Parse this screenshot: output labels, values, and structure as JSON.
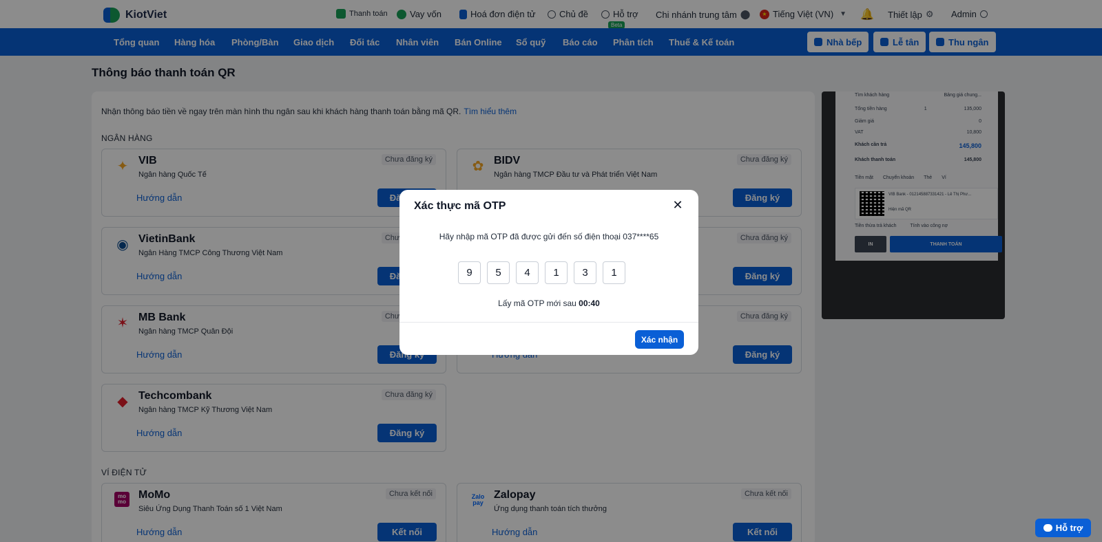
{
  "app": {
    "brand": "KiotViet"
  },
  "topbar": {
    "items": [
      {
        "label": "Thanh toán",
        "icon": "payment-icon"
      },
      {
        "label": "Vay vốn",
        "icon": "money-bag-icon"
      },
      {
        "label": "Hoá đơn điện tử",
        "icon": "invoice-icon"
      },
      {
        "label": "Chủ đề",
        "icon": "palette-icon"
      },
      {
        "label": "Hỗ trợ",
        "icon": "chat-icon"
      },
      {
        "label": "Chi nhánh trung tâm",
        "icon": "location-pin-icon"
      },
      {
        "label": "Tiếng Việt (VN)",
        "icon": "vietnam-flag-icon"
      },
      {
        "label": "Thiết lập",
        "icon": "gear-icon"
      },
      {
        "label": "Admin",
        "icon": "user-icon"
      }
    ],
    "beta_label": "Beta"
  },
  "nav": {
    "items": [
      "Tổng quan",
      "Hàng hóa",
      "Phòng/Bàn",
      "Giao dịch",
      "Đối tác",
      "Nhân viên",
      "Bán Online",
      "Sổ quỹ",
      "Báo cáo",
      "Phân tích",
      "Thuế & Kế toán"
    ],
    "buttons": [
      "Nhà bếp",
      "Lễ tân",
      "Thu ngân"
    ]
  },
  "page": {
    "title": "Thông báo thanh toán QR",
    "intro": "Nhận thông báo tiền về ngay trên màn hình thu ngân sau khi khách hàng thanh toán bằng mã QR.",
    "learn_more": "Tìm hiểu thêm",
    "section_banks": "NGÂN HÀNG",
    "section_wallets": "VÍ ĐIỆN TỬ",
    "guide_label": "Hướng dẫn",
    "register_label": "Đăng ký",
    "connect_label": "Kết nối",
    "status_unregistered": "Chưa đăng ký",
    "status_unconnected": "Chưa kết nối"
  },
  "banks": [
    {
      "name": "VIB",
      "desc": "Ngân hàng Quốc Tế",
      "logo_color": "#f5a623"
    },
    {
      "name": "BIDV",
      "desc": "Ngân hàng TMCP Đầu tư và Phát triển Việt Nam",
      "logo_color": "#f5a623"
    },
    {
      "name": "VietinBank",
      "desc": "Ngân Hàng TMCP Công Thương Việt Nam",
      "logo_color": "#0a4a8f"
    },
    {
      "name": "MB Bank",
      "desc": "Ngân hàng TMCP Quân Đội",
      "logo_color": "#e01e2b"
    },
    {
      "name": "Techcombank",
      "desc": "Ngân hàng TMCP Kỹ Thương Việt Nam",
      "logo_color": "#e01e2b"
    }
  ],
  "wallets": [
    {
      "name": "MoMo",
      "desc": "Siêu Ứng Dụng Thanh Toán số 1 Việt Nam",
      "logo_text": "mo mo",
      "logo_color": "#a50064"
    },
    {
      "name": "Zalopay",
      "desc": "Ứng dụng thanh toán tích thưởng",
      "logo_text": "Zalo pay",
      "logo_color": "#0068ff"
    }
  ],
  "preview": {
    "search_placeholder": "Tìm khách hàng",
    "price_list": "Bảng giá chung...",
    "rows": [
      {
        "label": "Tổng tiền hàng",
        "value": "135,000",
        "qty": "1"
      },
      {
        "label": "Giảm giá",
        "value": "0"
      },
      {
        "label": "VAT",
        "value": "10,800"
      },
      {
        "label": "Khách cần trả",
        "value": "145,800"
      },
      {
        "label": "Khách thanh toán",
        "value": "145,800"
      }
    ],
    "methods": [
      "Tiền mặt",
      "Chuyển khoản",
      "Thẻ",
      "Ví"
    ],
    "bank_account": "VIB Bank - 012145887331421 - Lê Thị Phư...",
    "show_qr": "Hiện mã QR",
    "change_options": [
      "Tiền thừa trả khách",
      "Tính vào công nợ"
    ],
    "btn_print": "IN",
    "btn_pay": "THANH TOÁN"
  },
  "modal": {
    "title": "Xác thực mã OTP",
    "message": "Hãy nhập mã OTP đã được gửi đến số điện thoại 037****65",
    "digits": [
      "9",
      "5",
      "4",
      "1",
      "3",
      "1"
    ],
    "resend_prefix": "Lấy mã OTP mới sau",
    "countdown": "00:40",
    "confirm_label": "Xác nhận"
  },
  "support": {
    "label": "Hỗ trợ"
  }
}
